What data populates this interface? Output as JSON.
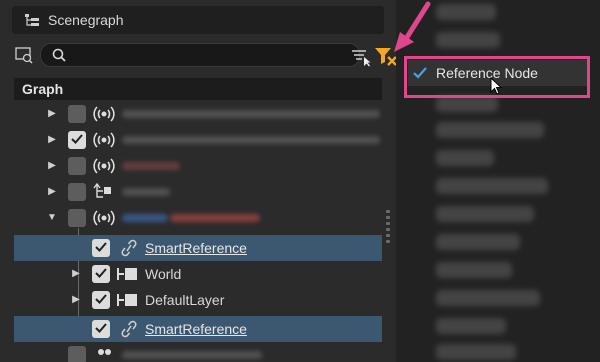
{
  "panel": {
    "title": "Scenegraph",
    "title_icon": "scenegraph-icon"
  },
  "search": {
    "value": "",
    "placeholder": ""
  },
  "graph": {
    "header": "Graph"
  },
  "tree": {
    "rows": [
      {
        "expander": "collapsed",
        "checked": false,
        "icon": "broadcast-icon",
        "label": "",
        "obscured": true
      },
      {
        "expander": "collapsed",
        "checked": true,
        "icon": "broadcast-icon",
        "label": "",
        "obscured": true
      },
      {
        "expander": "collapsed",
        "checked": false,
        "icon": "broadcast-icon",
        "label": "",
        "obscured": true
      },
      {
        "expander": "collapsed",
        "checked": false,
        "icon": "hierarchy-node-icon",
        "label": "",
        "obscured": true
      },
      {
        "expander": "expanded",
        "checked": false,
        "icon": "broadcast-icon",
        "label": "",
        "obscured": true
      },
      {
        "expander": "none",
        "checked": true,
        "icon": "link-icon",
        "label": "SmartReference",
        "selected": true
      },
      {
        "expander": "collapsed",
        "checked": true,
        "icon": "node-icon",
        "label": "World"
      },
      {
        "expander": "collapsed",
        "checked": true,
        "icon": "node-icon",
        "label": "DefaultLayer"
      },
      {
        "expander": "none",
        "checked": true,
        "icon": "link-icon",
        "label": "SmartReference",
        "selected": true
      }
    ]
  },
  "menu": {
    "selected_item": {
      "label": "Reference Node",
      "checked": true
    }
  },
  "colors": {
    "selection": "#3c5870",
    "highlight": "#e0468c",
    "accent": "#f5a623",
    "check": "#4aa0e0"
  }
}
